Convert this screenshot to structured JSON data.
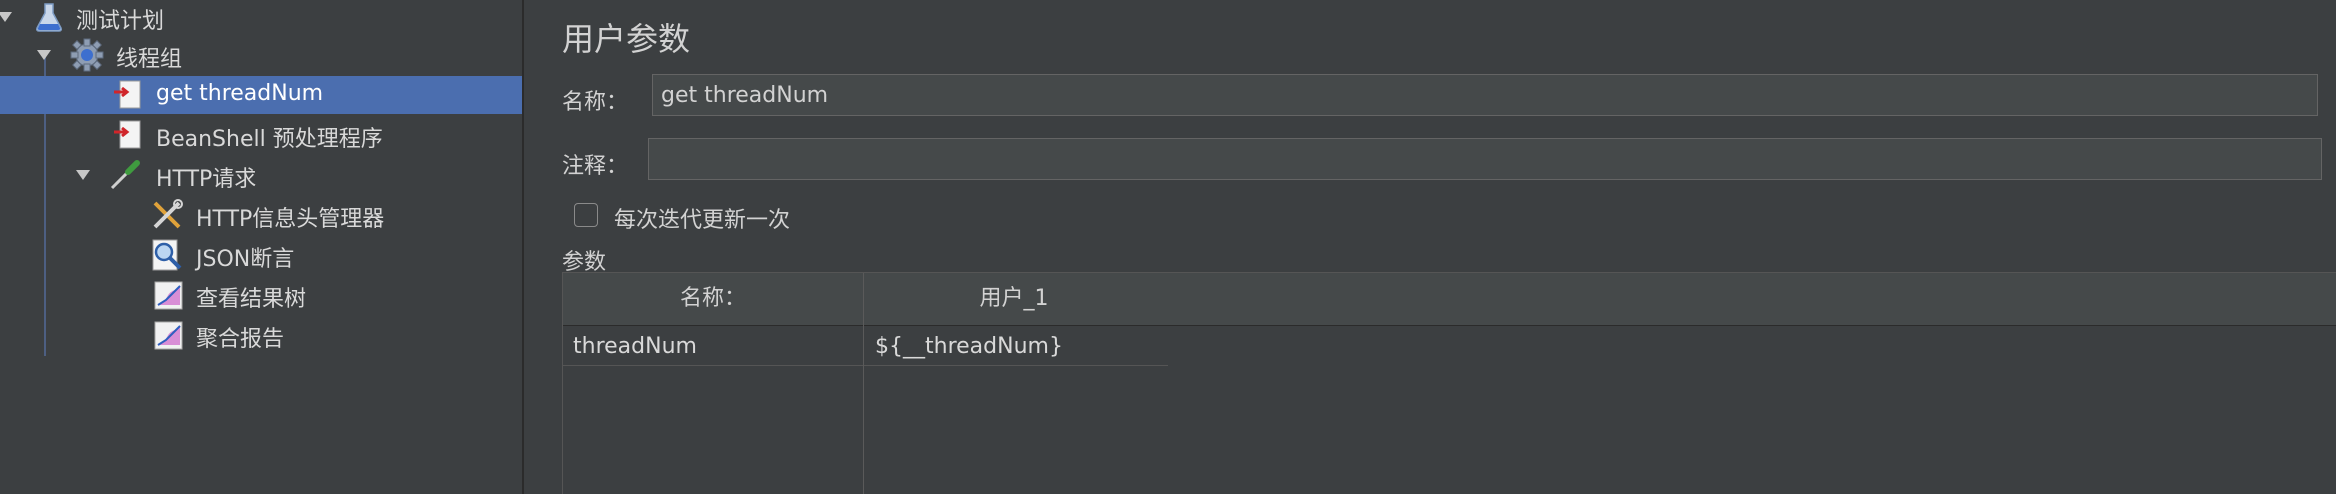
{
  "tree": {
    "items": [
      {
        "label": "测试计划",
        "icon": "flask-icon"
      },
      {
        "label": "线程组",
        "icon": "gear-icon"
      },
      {
        "label": "get threadNum",
        "icon": "preprocessor-icon",
        "selected": true
      },
      {
        "label": "BeanShell 预处理程序",
        "icon": "preprocessor-icon"
      },
      {
        "label": "HTTP请求",
        "icon": "pipette-icon"
      },
      {
        "label": "HTTP信息头管理器",
        "icon": "tools-icon"
      },
      {
        "label": "JSON断言",
        "icon": "magnifier-icon"
      },
      {
        "label": "查看结果树",
        "icon": "graph-icon"
      },
      {
        "label": "聚合报告",
        "icon": "graph-icon"
      }
    ]
  },
  "panel": {
    "title": "用户参数",
    "name_label": "名称：",
    "name_value": "get threadNum",
    "comment_label": "注释：",
    "comment_value": "",
    "per_iteration_label": "每次迭代更新一次",
    "params_label": "参数",
    "table": {
      "columns": [
        "名称：",
        "用户_1"
      ],
      "rows": [
        [
          "threadNum",
          "${__threadNum}"
        ]
      ]
    }
  },
  "colors": {
    "selection": "#4b6eaf",
    "background": "#3c3f41"
  }
}
